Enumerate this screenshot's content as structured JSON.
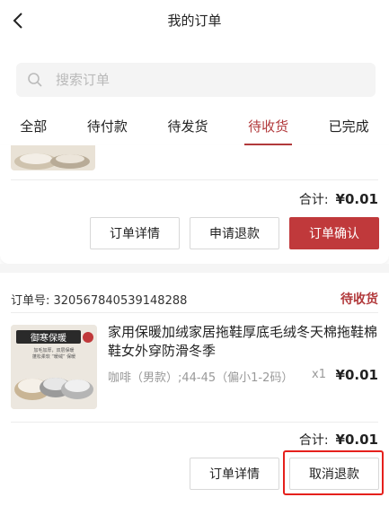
{
  "header": {
    "title": "我的订单",
    "back_icon": "back-arrow-icon"
  },
  "search": {
    "placeholder": "搜索订单",
    "value": ""
  },
  "tabs": [
    {
      "label": "全部",
      "active": false
    },
    {
      "label": "待付款",
      "active": false
    },
    {
      "label": "待发货",
      "active": false
    },
    {
      "label": "待收货",
      "active": true
    },
    {
      "label": "已完成",
      "active": false
    }
  ],
  "orders": [
    {
      "total_label": "合计:",
      "total_amount": "¥0.01",
      "buttons": [
        "订单详情",
        "申请退款",
        "订单确认"
      ]
    },
    {
      "order_no_label": "订单号: 320567840539148288",
      "status": "待收货",
      "thumb_text": {
        "title": "御寒保暖",
        "line1": "加毛加厚，双层保暖",
        "line2": "蓬松柔软 “暖绒” 保暖"
      },
      "product_title": "家用保暖加绒家居拖鞋厚底毛绒冬天棉拖鞋棉鞋女外穿防滑冬季",
      "spec": "咖啡（男款）;44-45（偏小1-2码）",
      "qty": "x1",
      "price": "¥0.01",
      "total_label": "合计:",
      "total_amount": "¥0.01",
      "buttons": [
        "订单详情",
        "取消退款"
      ]
    }
  ],
  "colors": {
    "accent": "#c0393b",
    "highlight": "#e5201c"
  }
}
